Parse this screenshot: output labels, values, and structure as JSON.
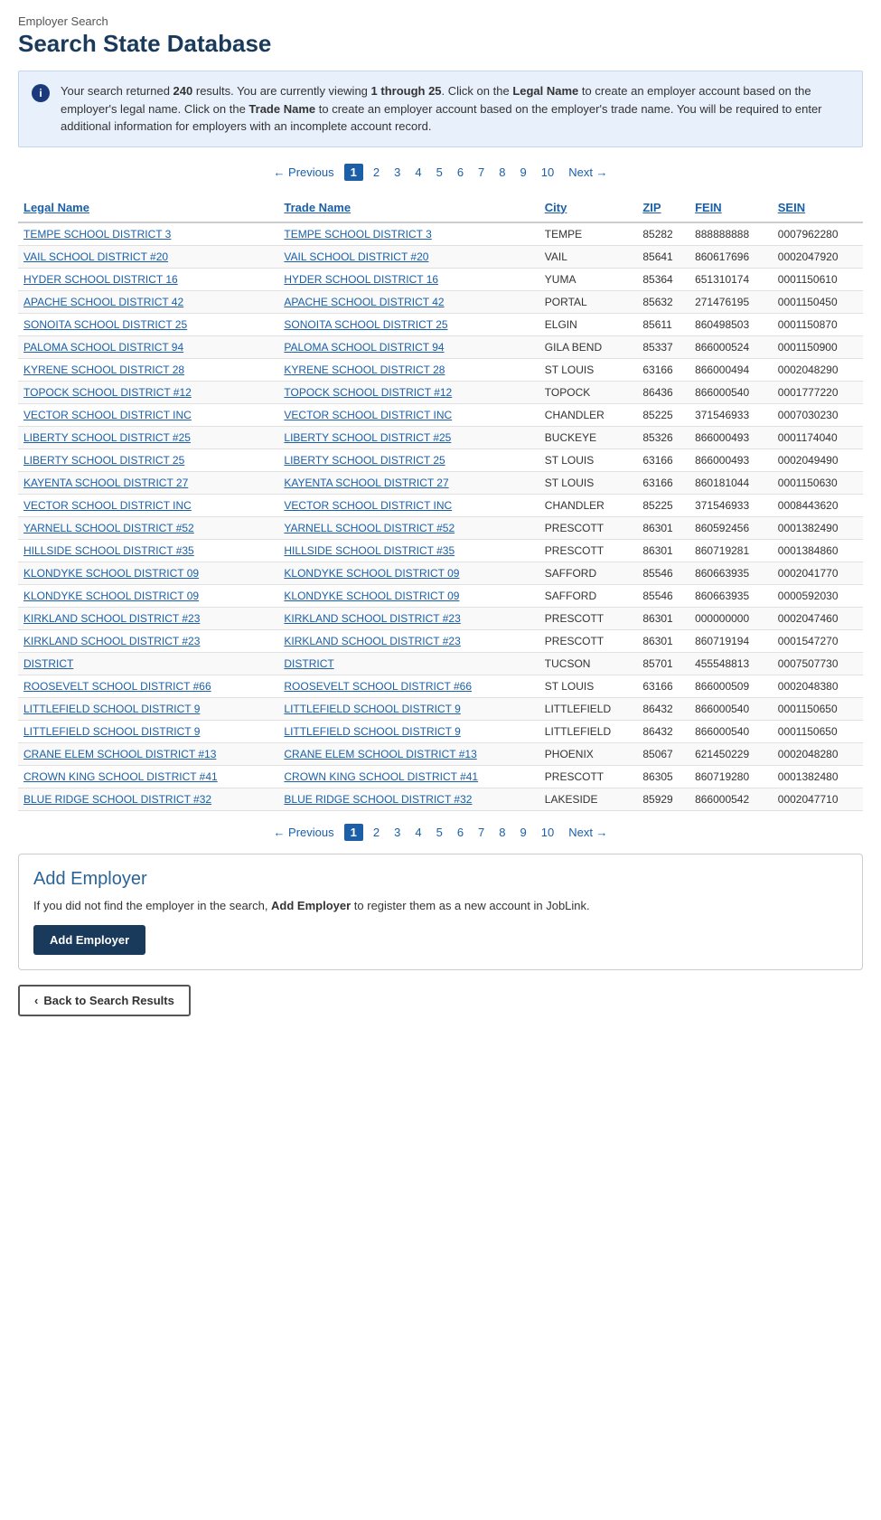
{
  "page": {
    "subtitle": "Employer Search",
    "title": "Search State Database"
  },
  "info": {
    "icon": "i",
    "text_parts": [
      "Your search returned ",
      "240",
      " results. You are currently viewing ",
      "1 through 25",
      ". Click on the ",
      "Legal Name",
      " to create an employer account based on the employer's legal name. Click on the ",
      "Trade Name",
      " to create an employer account based on the employer's trade name. You will be required to enter additional information for employers with an incomplete account record."
    ]
  },
  "pagination": {
    "prev_label": "← Previous",
    "next_label": "Next →",
    "current": 1,
    "pages": [
      "1",
      "2",
      "3",
      "4",
      "5",
      "6",
      "7",
      "8",
      "9",
      "10"
    ]
  },
  "table": {
    "headers": [
      {
        "label": "Legal Name",
        "key": "legal_name"
      },
      {
        "label": "Trade Name",
        "key": "trade_name"
      },
      {
        "label": "City",
        "key": "city"
      },
      {
        "label": "ZIP",
        "key": "zip"
      },
      {
        "label": "FEIN",
        "key": "fein"
      },
      {
        "label": "SEIN",
        "key": "sein"
      }
    ],
    "rows": [
      {
        "legal_name": "TEMPE SCHOOL DISTRICT 3",
        "trade_name": "TEMPE SCHOOL DISTRICT 3",
        "city": "TEMPE",
        "zip": "85282",
        "fein": "888888888",
        "sein": "0007962280"
      },
      {
        "legal_name": "VAIL SCHOOL DISTRICT #20",
        "trade_name": "VAIL SCHOOL DISTRICT #20",
        "city": "VAIL",
        "zip": "85641",
        "fein": "860617696",
        "sein": "0002047920"
      },
      {
        "legal_name": "HYDER SCHOOL DISTRICT 16",
        "trade_name": "HYDER SCHOOL DISTRICT 16",
        "city": "YUMA",
        "zip": "85364",
        "fein": "651310174",
        "sein": "0001150610"
      },
      {
        "legal_name": "APACHE SCHOOL DISTRICT 42",
        "trade_name": "APACHE SCHOOL DISTRICT 42",
        "city": "PORTAL",
        "zip": "85632",
        "fein": "271476195",
        "sein": "0001150450"
      },
      {
        "legal_name": "SONOITA SCHOOL DISTRICT 25",
        "trade_name": "SONOITA SCHOOL DISTRICT 25",
        "city": "ELGIN",
        "zip": "85611",
        "fein": "860498503",
        "sein": "0001150870"
      },
      {
        "legal_name": "PALOMA SCHOOL DISTRICT 94",
        "trade_name": "PALOMA SCHOOL DISTRICT 94",
        "city": "GILA BEND",
        "zip": "85337",
        "fein": "866000524",
        "sein": "0001150900"
      },
      {
        "legal_name": "KYRENE SCHOOL DISTRICT 28",
        "trade_name": "KYRENE SCHOOL DISTRICT 28",
        "city": "ST LOUIS",
        "zip": "63166",
        "fein": "866000494",
        "sein": "0002048290"
      },
      {
        "legal_name": "TOPOCK SCHOOL DISTRICT #12",
        "trade_name": "TOPOCK SCHOOL DISTRICT #12",
        "city": "TOPOCK",
        "zip": "86436",
        "fein": "866000540",
        "sein": "0001777220"
      },
      {
        "legal_name": "VECTOR SCHOOL DISTRICT INC",
        "trade_name": "VECTOR SCHOOL DISTRICT INC",
        "city": "CHANDLER",
        "zip": "85225",
        "fein": "371546933",
        "sein": "0007030230"
      },
      {
        "legal_name": "LIBERTY SCHOOL DISTRICT #25",
        "trade_name": "LIBERTY SCHOOL DISTRICT #25",
        "city": "BUCKEYE",
        "zip": "85326",
        "fein": "866000493",
        "sein": "0001174040"
      },
      {
        "legal_name": "LIBERTY SCHOOL DISTRICT 25",
        "trade_name": "LIBERTY SCHOOL DISTRICT 25",
        "city": "ST LOUIS",
        "zip": "63166",
        "fein": "866000493",
        "sein": "0002049490"
      },
      {
        "legal_name": "KAYENTA SCHOOL DISTRICT 27",
        "trade_name": "KAYENTA SCHOOL DISTRICT 27",
        "city": "ST LOUIS",
        "zip": "63166",
        "fein": "860181044",
        "sein": "0001150630"
      },
      {
        "legal_name": "VECTOR SCHOOL DISTRICT INC",
        "trade_name": "VECTOR SCHOOL DISTRICT INC",
        "city": "CHANDLER",
        "zip": "85225",
        "fein": "371546933",
        "sein": "0008443620"
      },
      {
        "legal_name": "YARNELL SCHOOL DISTRICT #52",
        "trade_name": "YARNELL SCHOOL DISTRICT #52",
        "city": "PRESCOTT",
        "zip": "86301",
        "fein": "860592456",
        "sein": "0001382490"
      },
      {
        "legal_name": "HILLSIDE SCHOOL DISTRICT #35",
        "trade_name": "HILLSIDE SCHOOL DISTRICT #35",
        "city": "PRESCOTT",
        "zip": "86301",
        "fein": "860719281",
        "sein": "0001384860"
      },
      {
        "legal_name": "KLONDYKE SCHOOL DISTRICT 09",
        "trade_name": "KLONDYKE SCHOOL DISTRICT 09",
        "city": "SAFFORD",
        "zip": "85546",
        "fein": "860663935",
        "sein": "0002041770"
      },
      {
        "legal_name": "KLONDYKE SCHOOL DISTRICT 09",
        "trade_name": "KLONDYKE SCHOOL DISTRICT 09",
        "city": "SAFFORD",
        "zip": "85546",
        "fein": "860663935",
        "sein": "0000592030"
      },
      {
        "legal_name": "KIRKLAND SCHOOL DISTRICT #23",
        "trade_name": "KIRKLAND SCHOOL DISTRICT #23",
        "city": "PRESCOTT",
        "zip": "86301",
        "fein": "000000000",
        "sein": "0002047460"
      },
      {
        "legal_name": "KIRKLAND SCHOOL DISTRICT #23",
        "trade_name": "KIRKLAND SCHOOL DISTRICT #23",
        "city": "PRESCOTT",
        "zip": "86301",
        "fein": "860719194",
        "sein": "0001547270"
      },
      {
        "legal_name": "DISTRICT",
        "trade_name": "DISTRICT",
        "city": "TUCSON",
        "zip": "85701",
        "fein": "455548813",
        "sein": "0007507730"
      },
      {
        "legal_name": "ROOSEVELT SCHOOL DISTRICT #66",
        "trade_name": "ROOSEVELT SCHOOL DISTRICT #66",
        "city": "ST LOUIS",
        "zip": "63166",
        "fein": "866000509",
        "sein": "0002048380"
      },
      {
        "legal_name": "LITTLEFIELD SCHOOL DISTRICT 9",
        "trade_name": "LITTLEFIELD SCHOOL DISTRICT 9",
        "city": "LITTLEFIELD",
        "zip": "86432",
        "fein": "866000540",
        "sein": "0001150650"
      },
      {
        "legal_name": "LITTLEFIELD SCHOOL DISTRICT 9",
        "trade_name": "LITTLEFIELD SCHOOL DISTRICT 9",
        "city": "LITTLEFIELD",
        "zip": "86432",
        "fein": "866000540",
        "sein": "0001150650"
      },
      {
        "legal_name": "CRANE ELEM SCHOOL DISTRICT #13",
        "trade_name": "CRANE ELEM SCHOOL DISTRICT #13",
        "city": "PHOENIX",
        "zip": "85067",
        "fein": "621450229",
        "sein": "0002048280"
      },
      {
        "legal_name": "CROWN KING SCHOOL DISTRICT #41",
        "trade_name": "CROWN KING SCHOOL DISTRICT #41",
        "city": "PRESCOTT",
        "zip": "86305",
        "fein": "860719280",
        "sein": "0001382480"
      },
      {
        "legal_name": "BLUE RIDGE SCHOOL DISTRICT #32",
        "trade_name": "BLUE RIDGE SCHOOL DISTRICT #32",
        "city": "LAKESIDE",
        "zip": "85929",
        "fein": "866000542",
        "sein": "0002047710"
      }
    ]
  },
  "add_employer": {
    "title": "Add Employer",
    "description_parts": [
      "If you did not find the employer in the search, ",
      "Add Employer",
      " to register them as a new account in JobLink."
    ],
    "button_label": "Add Employer"
  },
  "back_button": {
    "icon": "‹",
    "label": "Back to Search Results"
  }
}
